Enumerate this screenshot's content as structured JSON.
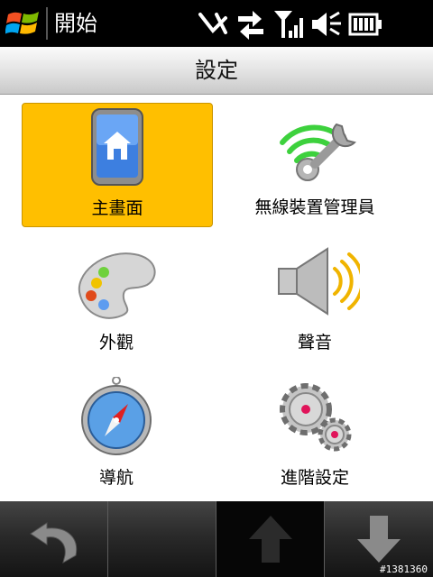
{
  "statusbar": {
    "start_label": "開始",
    "icons": [
      "windows-logo-icon",
      "sync-off-icon",
      "data-arrows-icon",
      "signal-icon",
      "volume-mute-icon",
      "battery-icon"
    ]
  },
  "header": {
    "title": "設定"
  },
  "grid": {
    "items": [
      {
        "label": "主畫面",
        "icon": "home-screen-icon",
        "selected": true
      },
      {
        "label": "無線裝置管理員",
        "icon": "wireless-manager-icon",
        "selected": false
      },
      {
        "label": "外觀",
        "icon": "palette-icon",
        "selected": false
      },
      {
        "label": "聲音",
        "icon": "speaker-icon",
        "selected": false
      },
      {
        "label": "導航",
        "icon": "compass-icon",
        "selected": false
      },
      {
        "label": "進階設定",
        "icon": "gears-icon",
        "selected": false
      }
    ]
  },
  "toolbar": {
    "buttons": [
      "back-icon",
      "",
      "up-arrow-icon",
      "down-arrow-icon"
    ]
  },
  "watermark": "#1381360",
  "colors": {
    "selection": "#ffbf00",
    "statusbar": "#000000",
    "wifi_green": "#3dd13d"
  }
}
